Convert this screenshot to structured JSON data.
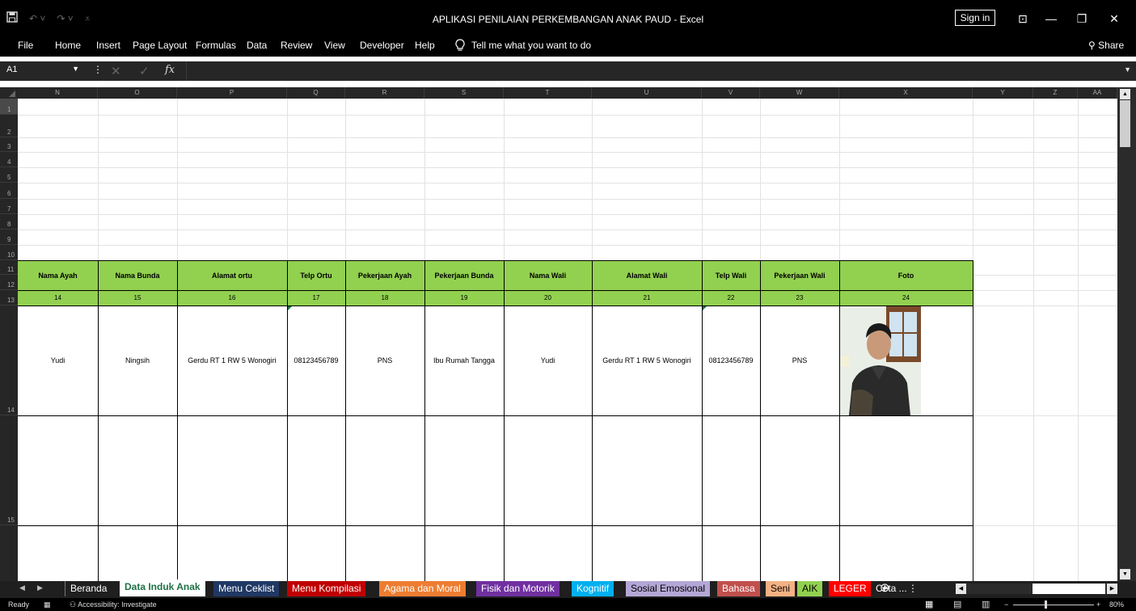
{
  "window": {
    "title": "APLIKASI PENILAIAN PERKEMBANGAN ANAK PAUD  -  Excel",
    "sign_in": "Sign in",
    "qat": {
      "save_icon": "save-icon",
      "undo_icon": "undo-icon",
      "redo_icon": "redo-icon"
    },
    "controls": {
      "ribbon_display": "⊡",
      "minimize": "—",
      "restore": "❐",
      "close": "✕"
    }
  },
  "ribbon": {
    "tabs": [
      "File",
      "Home",
      "Insert",
      "Page Layout",
      "Formulas",
      "Data",
      "Review",
      "View",
      "Developer",
      "Help"
    ],
    "tell_me": "Tell me what you want to do",
    "share": "Share"
  },
  "formula_bar": {
    "name_box": "A1",
    "cancel": "✕",
    "enter": "✓",
    "fx": "fx",
    "value": ""
  },
  "grid": {
    "columns": [
      "N",
      "O",
      "P",
      "Q",
      "R",
      "S",
      "T",
      "U",
      "V",
      "W",
      "X",
      "Y",
      "Z",
      "AA"
    ],
    "rows": [
      "1",
      "2",
      "3",
      "4",
      "5",
      "6",
      "7",
      "8",
      "9",
      "10",
      "11",
      "12",
      "13",
      "14",
      "15"
    ],
    "headers": [
      "Nama Ayah",
      "Nama Bunda",
      "Alamat ortu",
      "Telp Ortu",
      "Pekerjaan Ayah",
      "Pekerjaan Bunda",
      "Nama Wali",
      "Alamat Wali",
      "Telp Wali",
      "Pekerjaan Wali",
      "Foto"
    ],
    "numbers": [
      "14",
      "15",
      "16",
      "17",
      "18",
      "19",
      "20",
      "21",
      "22",
      "23",
      "24"
    ],
    "record": [
      "Yudi",
      "Ningsih",
      "Gerdu RT 1 RW 5 Wonogiri",
      "08123456789",
      "PNS",
      "Ibu Rumah Tangga",
      "Yudi",
      "Gerdu RT 1 RW 5 Wonogiri",
      "08123456789",
      "PNS"
    ]
  },
  "sheet_tabs": [
    {
      "label": "Beranda",
      "bg": "#1f1f1f",
      "fg": "#ffffff"
    },
    {
      "label": "Data Induk Anak",
      "bg": "#ffffff",
      "fg": "#1e7145",
      "active": true
    },
    {
      "label": "Menu Ceklist",
      "bg": "#1f3864",
      "fg": "#ffffff"
    },
    {
      "label": "Menu Kompilasi",
      "bg": "#c00000",
      "fg": "#ffffff"
    },
    {
      "label": "Agama dan Moral",
      "bg": "#ed7d31",
      "fg": "#ffffff"
    },
    {
      "label": "Fisik dan Motorik",
      "bg": "#7030a0",
      "fg": "#ffffff"
    },
    {
      "label": "Kognitif",
      "bg": "#00b0f0",
      "fg": "#ffffff"
    },
    {
      "label": "Sosial Emosional",
      "bg": "#b4a7d6",
      "fg": "#000000"
    },
    {
      "label": "Bahasa",
      "bg": "#c0504d",
      "fg": "#ffffff"
    },
    {
      "label": "Seni",
      "bg": "#f4b183",
      "fg": "#000000"
    },
    {
      "label": "AIK",
      "bg": "#92d050",
      "fg": "#000000"
    },
    {
      "label": "LEGER",
      "bg": "#ff0000",
      "fg": "#ffffff"
    },
    {
      "label": "Ceta ...",
      "bg": "#1f1f1f",
      "fg": "#ffffff"
    }
  ],
  "status_bar": {
    "ready": "Ready",
    "accessibility": "Accessibility: Investigate",
    "zoom": "80%",
    "zoom_out": "−",
    "zoom_in": "+"
  }
}
